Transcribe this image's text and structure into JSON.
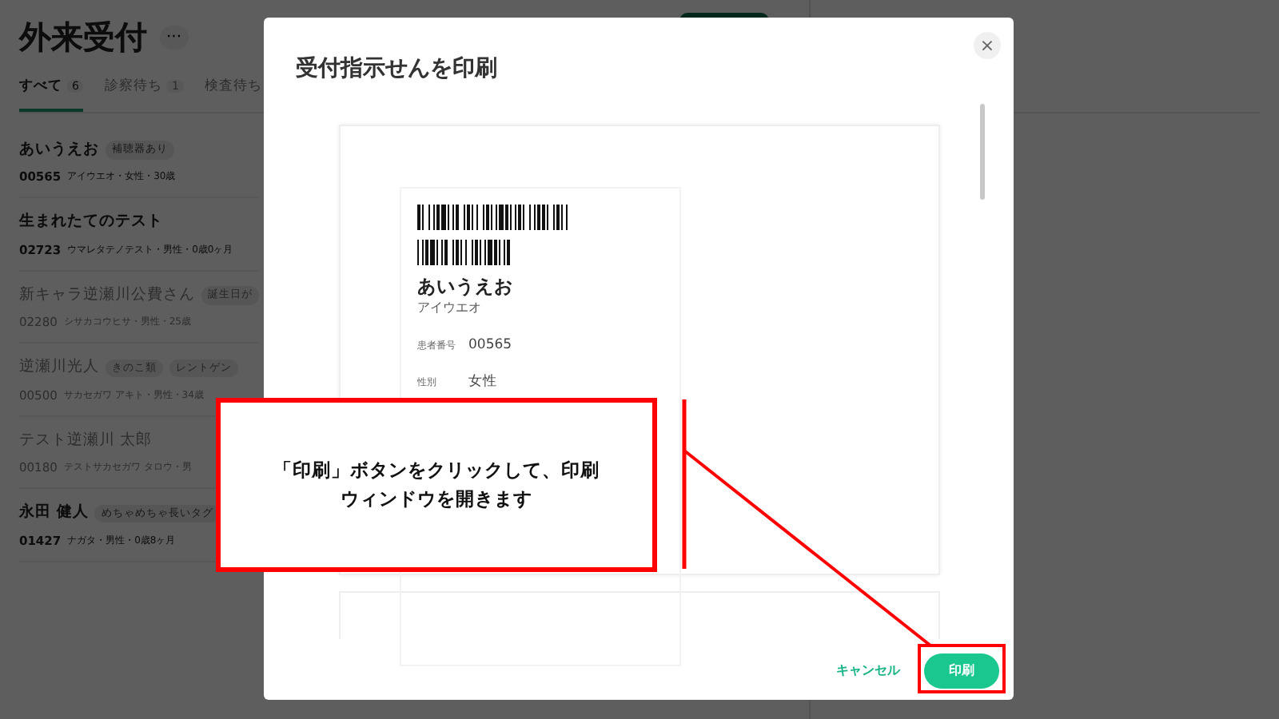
{
  "page": {
    "title": "外来受付",
    "more": "···",
    "tabs": [
      {
        "label": "すべて",
        "count": "6",
        "selected": true
      },
      {
        "label": "診察待ち",
        "count": "1",
        "selected": false
      },
      {
        "label": "検査待ち",
        "selected": false
      }
    ],
    "patients": [
      {
        "name": "あいうえお",
        "tags": [
          "補聴器あり"
        ],
        "id": "00565",
        "detail": "アイウエオ・女性・30歳",
        "disabled": false
      },
      {
        "name": "生まれたてのテスト",
        "id": "02723",
        "detail": "ウマレタテノテスト・男性・0歳0ヶ月",
        "disabled": false
      },
      {
        "name": "新キャラ逆瀬川公費さん",
        "tags": [
          "誕生日が"
        ],
        "id": "02280",
        "detail": "シサカコウヒサ・男性・25歳",
        "disabled": true
      },
      {
        "name": "逆瀬川光人",
        "tags": [
          "きのこ類",
          "レントゲン"
        ],
        "id": "00500",
        "detail": "サカセガワ アキト・男性・34歳",
        "disabled": true
      },
      {
        "name": "テスト逆瀬川 太郎",
        "id": "00180",
        "detail": "テストサカセガワ タロウ・男",
        "disabled": true
      },
      {
        "name": "永田 健人",
        "tags": [
          "めちゃめちゃ長いタグ"
        ],
        "id": "01427",
        "detail": "ナガタ・男性・0歳8ヶ月",
        "disabled": false
      }
    ]
  },
  "modal": {
    "title": "受付指示せんを印刷",
    "close": "×",
    "label": {
      "name": "あいうえお",
      "kana": "アイウエオ",
      "fields": [
        {
          "label": "患者番号",
          "value": "00565"
        },
        {
          "label": "性別",
          "value": "女性"
        }
      ]
    },
    "cancel": "キャンセル",
    "print": "印刷"
  },
  "annotation": {
    "text": "「印刷」ボタンをクリックして、印刷ウィンドウを開きます"
  }
}
